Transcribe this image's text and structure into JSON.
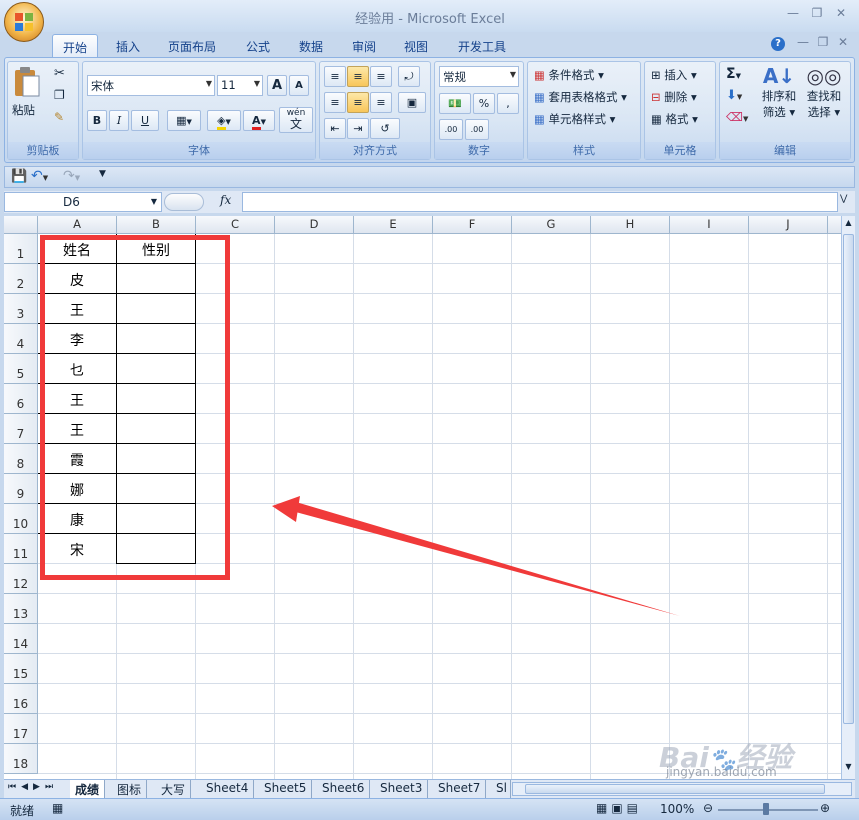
{
  "window": {
    "title": "经验用 - Microsoft Excel"
  },
  "tabs": [
    "开始",
    "插入",
    "页面布局",
    "公式",
    "数据",
    "审阅",
    "视图",
    "开发工具"
  ],
  "ribbon": {
    "clipboard": {
      "paste": "粘贴",
      "label": "剪贴板"
    },
    "font": {
      "name": "宋体",
      "size": "11",
      "label": "字体",
      "bold": "B",
      "italic": "I",
      "underline": "U",
      "grow": "A",
      "shrink": "A",
      "wen": "wén",
      "wen_char": "文",
      "font_color": "A"
    },
    "alignment": {
      "label": "对齐方式"
    },
    "number": {
      "format": "常规",
      "label": "数字",
      "percent": "%",
      "comma": ",",
      "inc": ".00",
      "dec": ".00"
    },
    "styles": {
      "cond": "条件格式",
      "table": "套用表格格式",
      "cell": "单元格样式",
      "label": "样式"
    },
    "cells": {
      "insert": "插入",
      "delete": "删除",
      "format": "格式",
      "label": "单元格"
    },
    "editing": {
      "sort": "排序和",
      "sort2": "筛选",
      "find": "查找和",
      "find2": "选择",
      "label": "编辑"
    }
  },
  "namebox": "D6",
  "fx": "fx",
  "columns": [
    "A",
    "B",
    "C",
    "D",
    "E",
    "F",
    "G",
    "H",
    "I",
    "J"
  ],
  "rows": [
    "1",
    "2",
    "3",
    "4",
    "5",
    "6",
    "7",
    "8",
    "9",
    "10",
    "11",
    "12",
    "13",
    "14",
    "15",
    "16",
    "17",
    "18"
  ],
  "cells": {
    "A1": "姓名",
    "B1": "性别",
    "A2": "皮",
    "A3": "王",
    "A4": "李",
    "A5": "乜",
    "A6": "王",
    "A7": "王",
    "A8": "霞",
    "A9": "娜",
    "A10": "康",
    "A11": "宋"
  },
  "sheets": [
    "成绩",
    "图标",
    "大写",
    "Sheet4",
    "Sheet5",
    "Sheet6",
    "Sheet3",
    "Sheet7",
    "Sl"
  ],
  "status": {
    "ready": "就绪",
    "zoom": "100%"
  },
  "watermark": "Baidu经验 jingyan.baidu.com",
  "colors": {
    "annotation": "#f03a3a",
    "ribbon": "#dfe9f5"
  }
}
